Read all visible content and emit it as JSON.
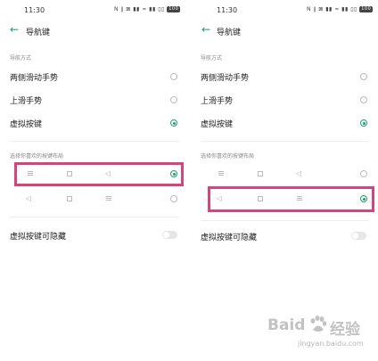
{
  "status_bar": {
    "time": "11:30",
    "indicators": "N ∥ ⊠ ▮▮ ≈ ▮▮ ▯▯",
    "battery": "100"
  },
  "header": {
    "title": "导航键"
  },
  "navigation_mode": {
    "section_label": "导航方式",
    "options": [
      {
        "label": "两侧滑动手势",
        "selected": false
      },
      {
        "label": "上滑手势",
        "selected": false
      },
      {
        "label": "虚拟按键",
        "selected": true
      }
    ]
  },
  "button_layout": {
    "section_label": "选择你喜欢的按键布局",
    "rows": [
      {
        "buttons": [
          "menu",
          "home",
          "back"
        ]
      },
      {
        "buttons": [
          "back",
          "home",
          "menu"
        ]
      }
    ]
  },
  "left_panel": {
    "layout_selected_index": 0
  },
  "right_panel": {
    "layout_selected_index": 1
  },
  "hide_setting": {
    "label": "虚拟按键可隐藏",
    "enabled": false
  },
  "watermark": {
    "brand": "Baid",
    "brand_suffix": "经验",
    "url": "jingyan.baidu.com"
  },
  "colors": {
    "accent": "#1aa06d",
    "highlight": "#d8437a"
  }
}
